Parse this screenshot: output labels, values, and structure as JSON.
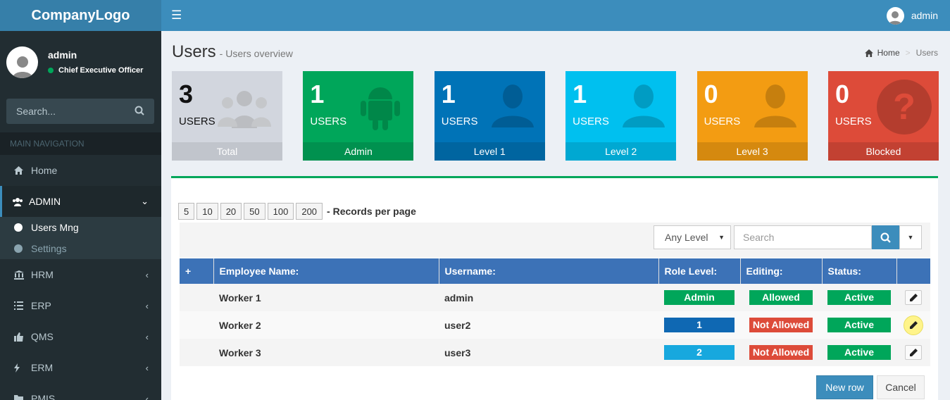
{
  "app": {
    "logo": "CompanyLogo"
  },
  "sidebar": {
    "user": {
      "name": "admin",
      "role": "Chief Executive Officer"
    },
    "search_placeholder": "Search...",
    "nav_header": "MAIN NAVIGATION",
    "items": [
      {
        "label": "Home",
        "icon": "home-icon"
      },
      {
        "label": "ADMIN",
        "icon": "users-icon",
        "expanded": true
      },
      {
        "label": "HRM",
        "icon": "bank-icon"
      },
      {
        "label": "ERP",
        "icon": "list-icon"
      },
      {
        "label": "QMS",
        "icon": "thumbs-up-icon"
      },
      {
        "label": "ERM",
        "icon": "bolt-icon"
      },
      {
        "label": "PMIS",
        "icon": "folder-icon"
      }
    ],
    "admin_subitems": [
      {
        "label": "Users Mng",
        "active": true
      },
      {
        "label": "Settings",
        "active": false
      }
    ]
  },
  "topbar": {
    "user_name": "admin"
  },
  "header": {
    "title": "Users",
    "subtitle": "- Users overview",
    "breadcrumb": {
      "home": "Home",
      "separator": ">",
      "current": "Users"
    }
  },
  "stats": [
    {
      "count": "3",
      "unit": "USERS",
      "label": "Total",
      "color": "#d2d6de",
      "icon": "group-icon"
    },
    {
      "count": "1",
      "unit": "USERS",
      "label": "Admin",
      "color": "#00a65a",
      "icon": "android-icon"
    },
    {
      "count": "1",
      "unit": "USERS",
      "label": "Level 1",
      "color": "#0073b7",
      "icon": "user-silhouette-icon"
    },
    {
      "count": "1",
      "unit": "USERS",
      "label": "Level 2",
      "color": "#00c0ef",
      "icon": "user-silhouette-icon"
    },
    {
      "count": "0",
      "unit": "USERS",
      "label": "Level 3",
      "color": "#f39c12",
      "icon": "user-silhouette-icon"
    },
    {
      "count": "0",
      "unit": "USERS",
      "label": "Blocked",
      "color": "#dd4b39",
      "icon": "question-circle-icon"
    }
  ],
  "records": {
    "options": [
      "5",
      "10",
      "20",
      "50",
      "100",
      "200"
    ],
    "label": "- Records per page"
  },
  "filter": {
    "level_value": "Any Level",
    "search_placeholder": "Search"
  },
  "table": {
    "headers": [
      "+",
      "Employee Name:",
      "Username:",
      "Role Level:",
      "Editing:",
      "Status:",
      ""
    ],
    "rows": [
      {
        "name": "Worker 1",
        "username": "admin",
        "role": "Admin",
        "role_color": "#00a65a",
        "editing": "Allowed",
        "editing_color": "#00a65a",
        "status": "Active"
      },
      {
        "name": "Worker 2",
        "username": "user2",
        "role": "1",
        "role_color": "#0f68b3",
        "editing": "Not Allowed",
        "editing_color": "#dd4b39",
        "status": "Active"
      },
      {
        "name": "Worker 3",
        "username": "user3",
        "role": "2",
        "role_color": "#17a8de",
        "editing": "Not Allowed",
        "editing_color": "#dd4b39",
        "status": "Active"
      }
    ]
  },
  "actions": {
    "new_row": "New row",
    "cancel": "Cancel"
  }
}
